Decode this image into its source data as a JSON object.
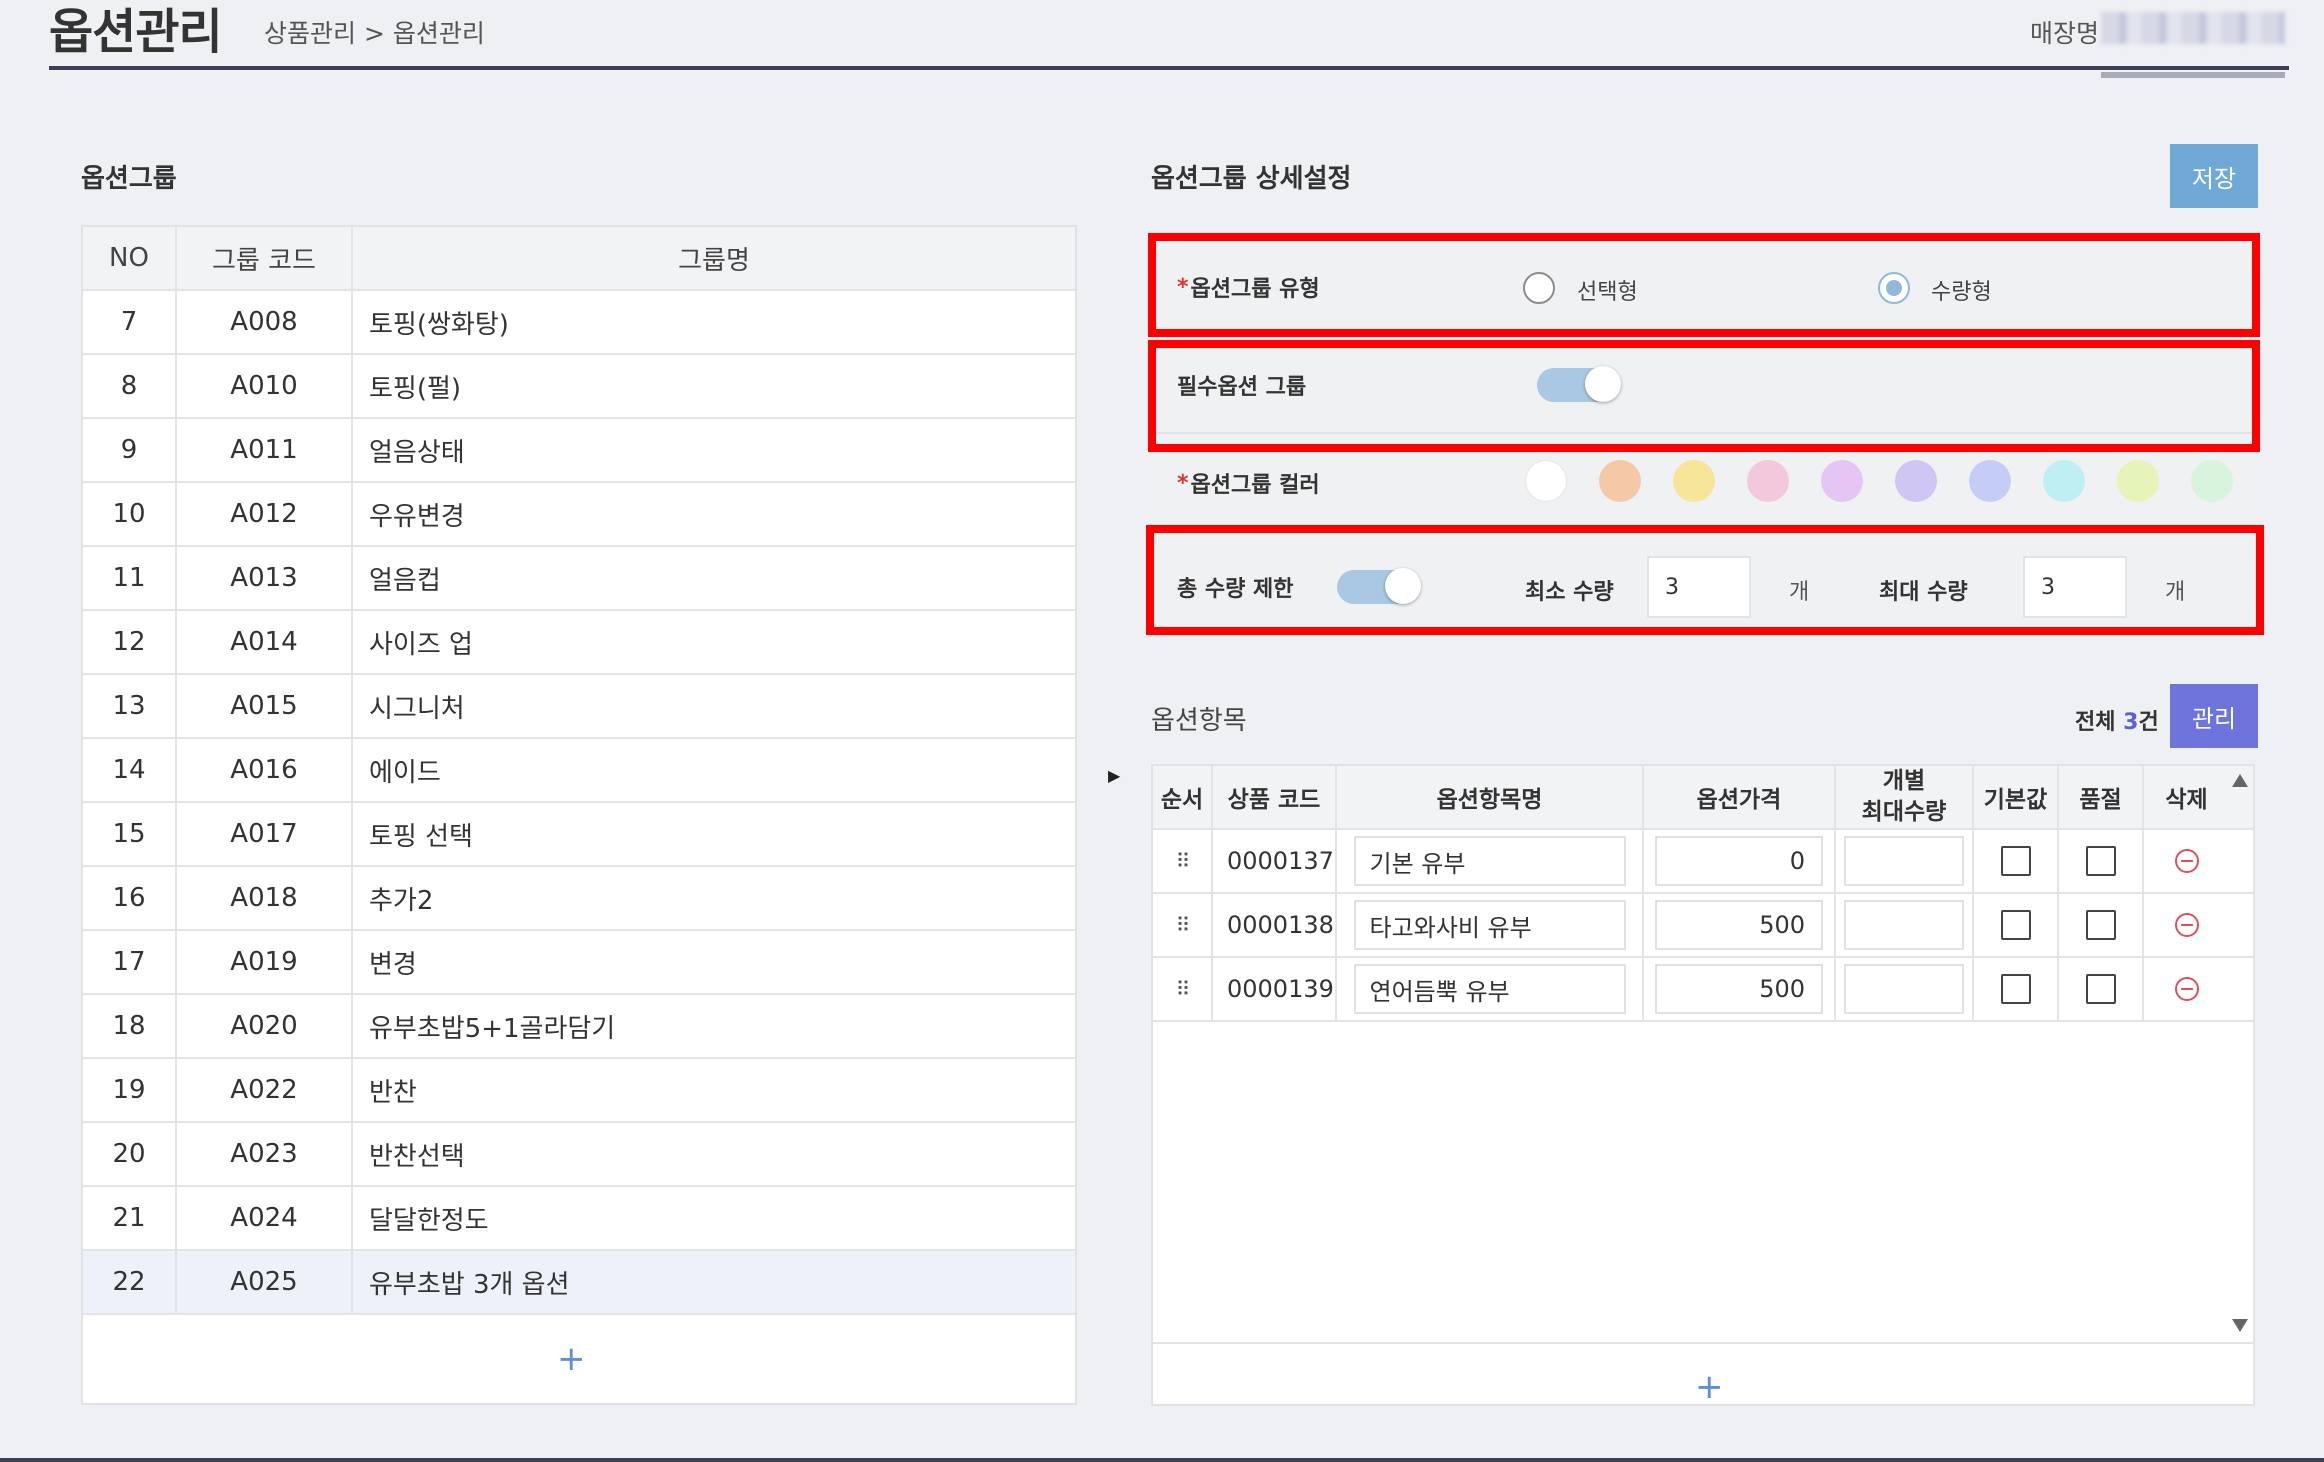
{
  "header": {
    "title": "옵션관리",
    "breadcrumb": "상품관리 > 옵션관리",
    "store_label": "매장명"
  },
  "group_section": {
    "title": "옵션그룹",
    "columns": {
      "no": "NO",
      "code": "그룹 코드",
      "name": "그룹명"
    },
    "rows": [
      {
        "no": "7",
        "code": "A008",
        "name": "토핑(쌍화탕)"
      },
      {
        "no": "8",
        "code": "A010",
        "name": "토핑(펄)"
      },
      {
        "no": "9",
        "code": "A011",
        "name": "얼음상태"
      },
      {
        "no": "10",
        "code": "A012",
        "name": "우유변경"
      },
      {
        "no": "11",
        "code": "A013",
        "name": "얼음컵"
      },
      {
        "no": "12",
        "code": "A014",
        "name": "사이즈 업"
      },
      {
        "no": "13",
        "code": "A015",
        "name": "시그니처"
      },
      {
        "no": "14",
        "code": "A016",
        "name": "에이드"
      },
      {
        "no": "15",
        "code": "A017",
        "name": "토핑 선택"
      },
      {
        "no": "16",
        "code": "A018",
        "name": "추가2"
      },
      {
        "no": "17",
        "code": "A019",
        "name": "변경"
      },
      {
        "no": "18",
        "code": "A020",
        "name": "유부초밥5+1골라담기"
      },
      {
        "no": "19",
        "code": "A022",
        "name": "반찬"
      },
      {
        "no": "20",
        "code": "A023",
        "name": "반찬선택"
      },
      {
        "no": "21",
        "code": "A024",
        "name": "달달한정도"
      },
      {
        "no": "22",
        "code": "A025",
        "name": "유부초밥 3개 옵션"
      }
    ],
    "add_label": "+"
  },
  "detail": {
    "title": "옵션그룹 상세설정",
    "save_label": "저장",
    "required_mark": "*",
    "type_label": "옵션그룹 유형",
    "type_options": [
      "선택형",
      "수량형"
    ],
    "type_selected": "수량형",
    "required_group_label": "필수옵션 그룹",
    "required_group_on": true,
    "color_label": "옵션그룹 컬러",
    "colors": [
      "#ffffff",
      "#f5c9a8",
      "#f7e59a",
      "#f3c7dc",
      "#e5c5f4",
      "#cfc6f4",
      "#c5cdf6",
      "#bfeff3",
      "#e6f4b8",
      "#d7f4dc"
    ],
    "qty_limit_label": "총 수량 제한",
    "qty_limit_on": true,
    "min_label": "최소 수량",
    "min_value": "3",
    "max_label": "최대 수량",
    "max_value": "3",
    "unit": "개"
  },
  "items": {
    "title": "옵션항목",
    "total_prefix": "전체 ",
    "total_count": "3",
    "total_suffix": "건",
    "manage_label": "관리",
    "columns": {
      "order": "순서",
      "code": "상품 코드",
      "name": "옵션항목명",
      "price": "옵션가격",
      "max_line1": "개별",
      "max_line2": "최대수량",
      "default": "기본값",
      "soldout": "품절",
      "delete": "삭제"
    },
    "rows": [
      {
        "code": "0000137",
        "name": "기본 유부",
        "price": "0",
        "max": ""
      },
      {
        "code": "0000138",
        "name": "타고와사비 유부",
        "price": "500",
        "max": ""
      },
      {
        "code": "0000139",
        "name": "연어듬뿍 유부",
        "price": "500",
        "max": ""
      }
    ],
    "add_label": "+"
  },
  "colors": {
    "accent_save": "#6fa9d8",
    "accent_manage": "#6f73dc",
    "highlight_border": "#ff0000",
    "header_rule": "#3c3f55"
  }
}
